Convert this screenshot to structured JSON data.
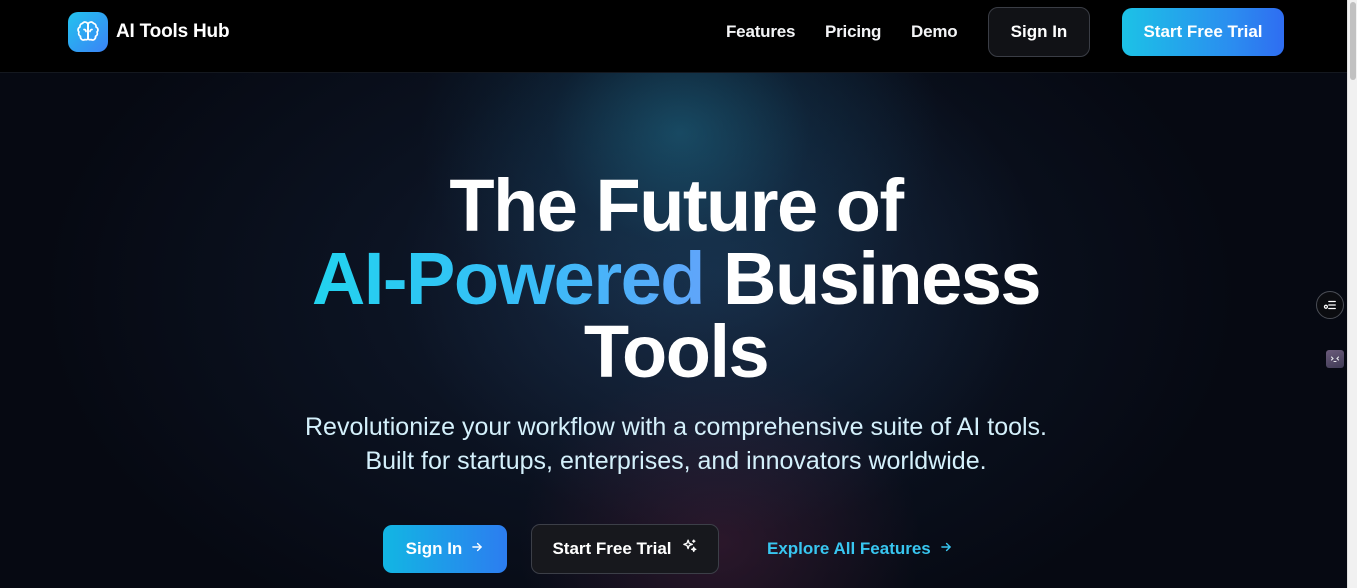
{
  "nav": {
    "brand_name": "AI Tools Hub",
    "logo_icon": "brain-icon",
    "links": [
      "Features",
      "Pricing",
      "Demo"
    ],
    "sign_in": "Sign In",
    "start_trial": "Start Free Trial"
  },
  "hero": {
    "title_line1": "The Future of",
    "title_accent": "AI-Powered",
    "title_line2_rest": " Business",
    "title_line3": "Tools",
    "subtitle_line1": "Revolutionize your workflow with a comprehensive suite of AI tools.",
    "subtitle_line2": "Built for startups, enterprises, and innovators worldwide.",
    "cta_sign_in": "Sign In",
    "cta_start_trial": "Start Free Trial",
    "cta_explore": "Explore All Features"
  },
  "icons": {
    "sign_in_arrow": "arrow-right-icon",
    "trial_sparkle": "sparkles-icon",
    "explore_arrow": "arrow-right-icon",
    "floating_menu": "menu-list-icon",
    "floating_assistant": "assistant-icon"
  },
  "colors": {
    "accent_cyan": "#22d3ee",
    "accent_blue": "#3b82f6",
    "background": "#000000"
  }
}
